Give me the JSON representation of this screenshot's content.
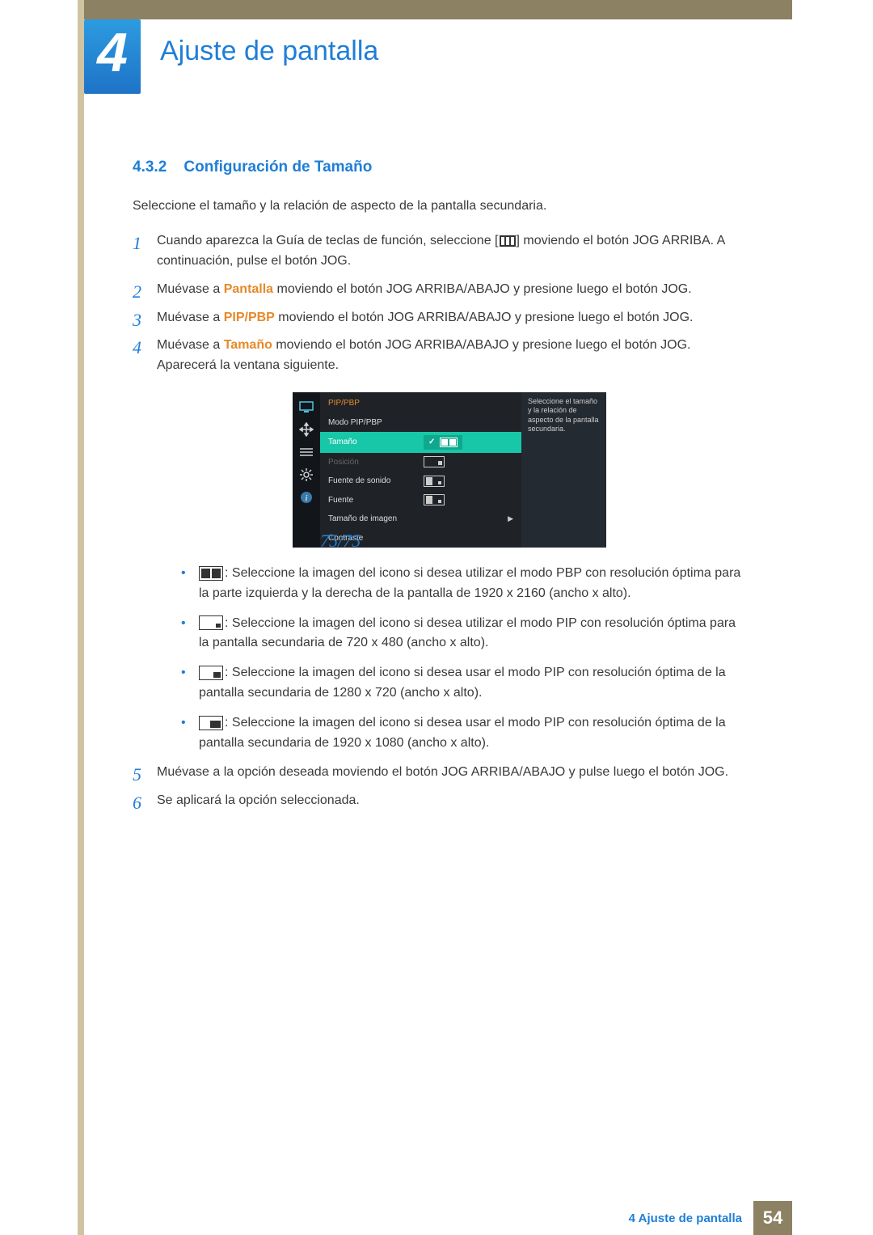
{
  "chapter": {
    "number": "4",
    "title": "Ajuste de pantalla"
  },
  "section": {
    "number": "4.3.2",
    "title": "Configuración de Tamaño",
    "intro": "Seleccione el tamaño y la relación de aspecto de la pantalla secundaria."
  },
  "steps": {
    "s1a": "Cuando aparezca la Guía de teclas de función, seleccione [",
    "s1b": "] moviendo el botón JOG ARRIBA. A continuación, pulse el botón JOG.",
    "s2_pre": "Muévase a ",
    "s2_hl": "Pantalla",
    "s2_post": " moviendo el botón JOG ARRIBA/ABAJO y presione luego el botón JOG.",
    "s3_pre": "Muévase a ",
    "s3_hl": "PIP/PBP",
    "s3_post": " moviendo el botón JOG ARRIBA/ABAJO y presione luego el botón JOG.",
    "s4_pre": "Muévase a ",
    "s4_hl": "Tamaño",
    "s4_post": " moviendo el botón JOG ARRIBA/ABAJO y presione luego el botón JOG. Aparecerá la ventana siguiente.",
    "s5": "Muévase a la opción deseada moviendo el botón JOG ARRIBA/ABAJO y pulse luego el botón JOG.",
    "s6": "Se aplicará la opción seleccionada."
  },
  "osd": {
    "title": "PIP/PBP",
    "help": "Seleccione el tamaño y la relación de aspecto de la pantalla secundaria.",
    "rows": {
      "mode": "Modo PIP/PBP",
      "size": "Tamaño",
      "pos": "Posición",
      "sound": "Fuente de sonido",
      "source": "Fuente",
      "imgsize": "Tamaño de imagen",
      "contrast": "Contraste",
      "contrast_val": "75/75"
    }
  },
  "bullets": {
    "b1": ": Seleccione la imagen del icono si desea utilizar el modo PBP con resolución óptima para la parte izquierda y la derecha de la pantalla de 1920 x 2160 (ancho x alto).",
    "b2": ": Seleccione la imagen del icono si desea utilizar el modo PIP con resolución óptima para la pantalla secundaria de 720 x 480 (ancho x alto).",
    "b3": ": Seleccione la imagen del icono si desea usar el modo PIP con resolución óptima de la pantalla secundaria de 1280 x 720 (ancho x alto).",
    "b4": ": Seleccione la imagen del icono si desea usar el modo PIP con resolución óptima de la pantalla secundaria de 1920 x 1080 (ancho x alto)."
  },
  "footer": {
    "text": "4 Ajuste de pantalla",
    "page": "54"
  }
}
